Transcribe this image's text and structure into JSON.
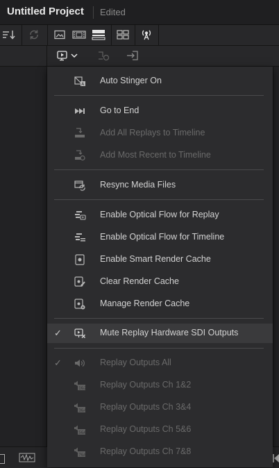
{
  "title": {
    "project": "Untitled Project",
    "status": "Edited"
  },
  "toolbar": {
    "top_icons": [
      "sort-icon",
      "sync-icon",
      "image-icon",
      "filmstrip-icon",
      "stacked-view-icon",
      "grid-view-icon",
      "broadcast-icon"
    ],
    "replay_dropdown_icon": "replay-monitor-icon"
  },
  "menu": {
    "items": [
      {
        "label": "Auto Stinger On",
        "icon": "stinger-icon",
        "checked": false,
        "disabled": false
      },
      {
        "label": "Go to End",
        "icon": "go-to-end-icon",
        "checked": false,
        "disabled": false
      },
      {
        "label": "Add All Replays to Timeline",
        "icon": "add-replays-icon",
        "checked": false,
        "disabled": true
      },
      {
        "label": "Add Most Recent to Timeline",
        "icon": "add-recent-icon",
        "checked": false,
        "disabled": true
      },
      {
        "label": "Resync Media Files",
        "icon": "resync-icon",
        "checked": false,
        "disabled": false
      },
      {
        "label": "Enable Optical Flow for Replay",
        "icon": "optical-flow-replay-icon",
        "checked": false,
        "disabled": false
      },
      {
        "label": "Enable Optical Flow for Timeline",
        "icon": "optical-flow-timeline-icon",
        "checked": false,
        "disabled": false
      },
      {
        "label": "Enable Smart Render Cache",
        "icon": "render-cache-icon",
        "checked": false,
        "disabled": false
      },
      {
        "label": "Clear Render Cache",
        "icon": "clear-cache-icon",
        "checked": false,
        "disabled": false
      },
      {
        "label": "Manage Render Cache",
        "icon": "manage-cache-icon",
        "checked": false,
        "disabled": false
      },
      {
        "label": "Mute Replay Hardware SDI Outputs",
        "icon": "mute-sdi-icon",
        "checked": true,
        "disabled": false,
        "highlighted": true
      },
      {
        "label": "Replay Outputs All",
        "icon": "speaker-icon",
        "checked": true,
        "disabled": true
      },
      {
        "label": "Replay Outputs Ch 1&2",
        "icon": "channel-12-icon",
        "checked": false,
        "disabled": true
      },
      {
        "label": "Replay Outputs Ch 3&4",
        "icon": "channel-34-icon",
        "checked": false,
        "disabled": true
      },
      {
        "label": "Replay Outputs Ch 5&6",
        "icon": "channel-56-icon",
        "checked": false,
        "disabled": true
      },
      {
        "label": "Replay Outputs Ch 7&8",
        "icon": "channel-78-icon",
        "checked": false,
        "disabled": true
      }
    ],
    "check_glyph": "✓"
  }
}
